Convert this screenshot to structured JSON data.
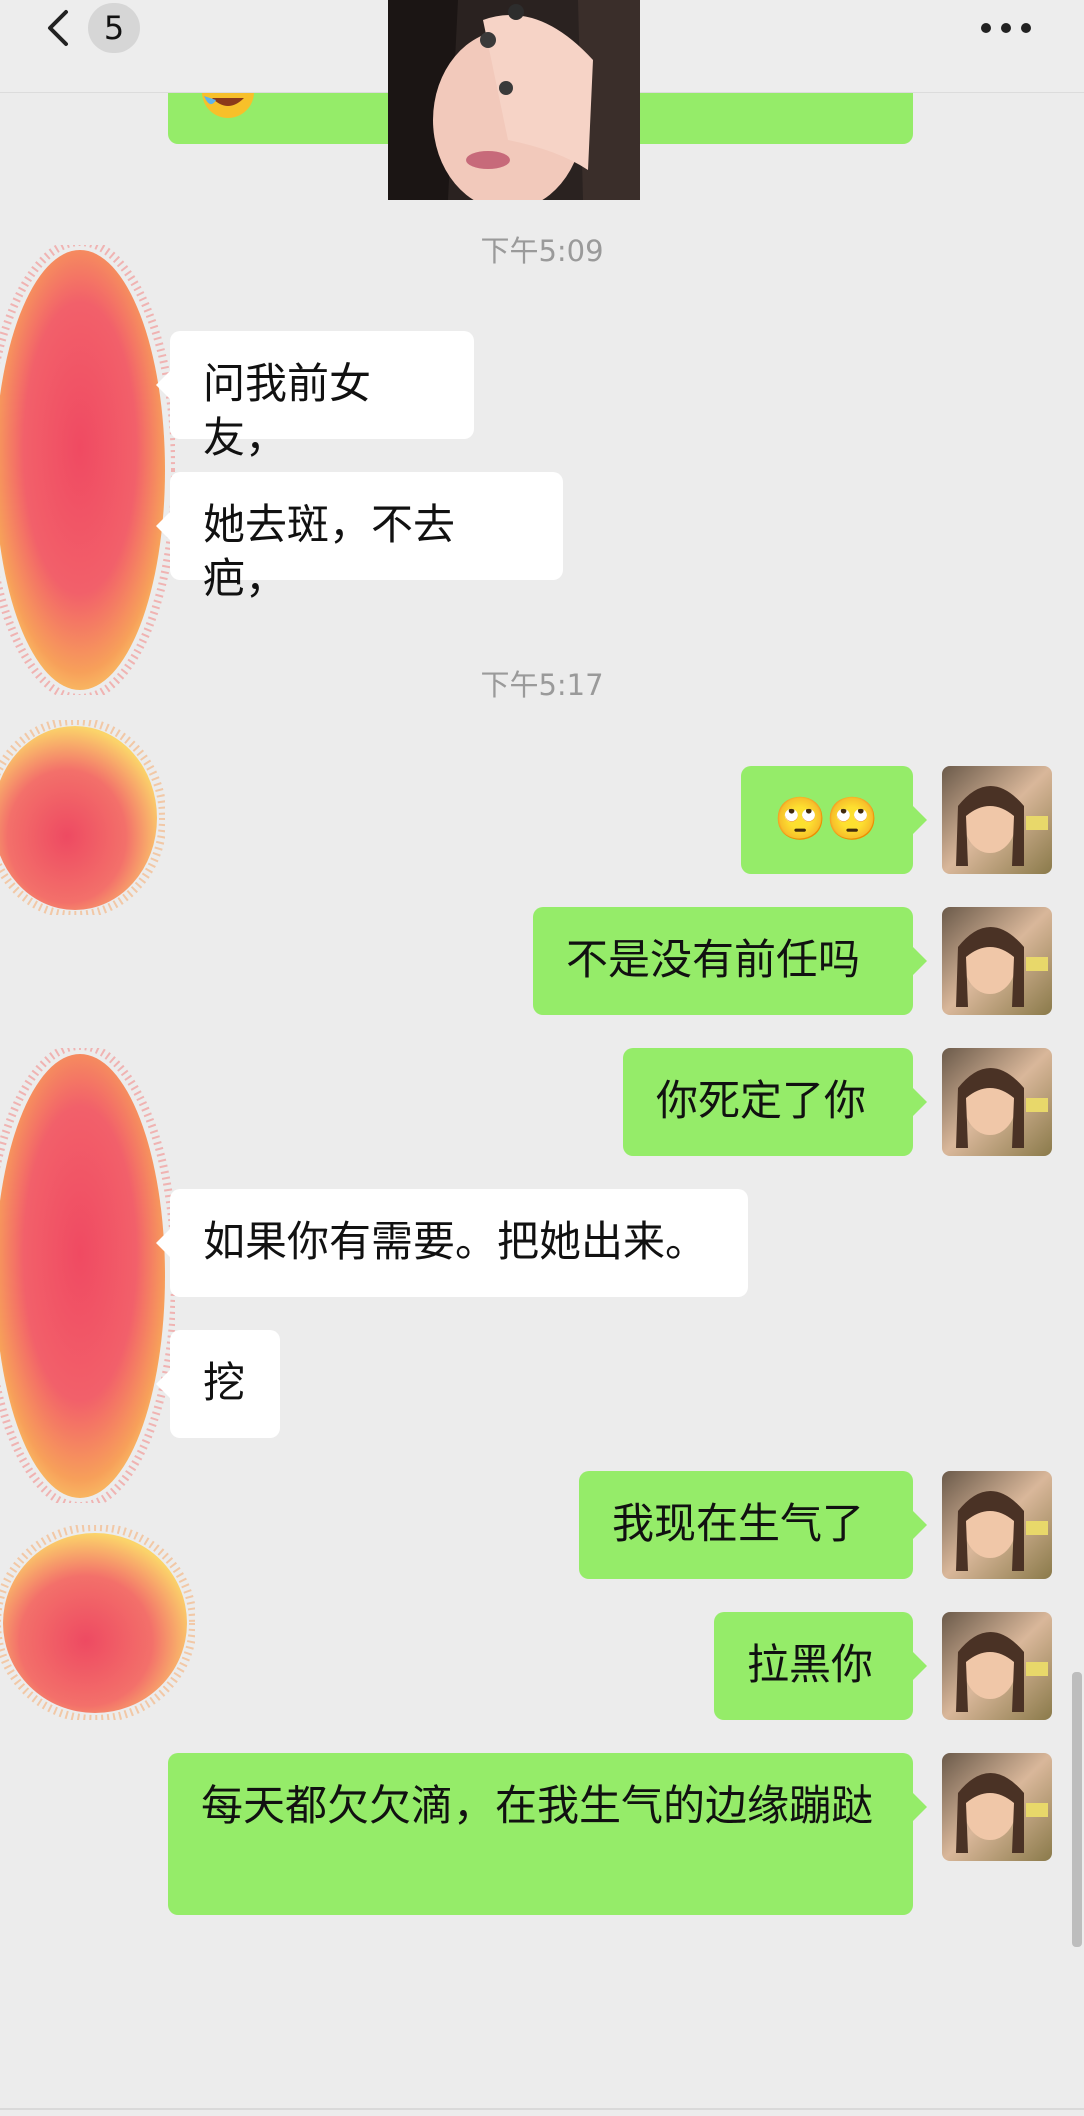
{
  "header": {
    "unread_count": "5",
    "back_icon": "chevron-left-icon",
    "more_icon": "more-dots-icon"
  },
  "messages": [
    {
      "type": "time",
      "text": "下午5:09"
    },
    {
      "type": "left",
      "text": "问我前女友，"
    },
    {
      "type": "left",
      "text": "她去斑，不去疤，"
    },
    {
      "type": "time",
      "text": "下午5:17"
    },
    {
      "type": "right",
      "text": "🙄🙄"
    },
    {
      "type": "right",
      "text": "不是没有前任吗"
    },
    {
      "type": "right",
      "text": "你死定了你"
    },
    {
      "type": "left",
      "text": "如果你有需要。把她出来。"
    },
    {
      "type": "left",
      "text": "挖"
    },
    {
      "type": "right",
      "text": "我现在生气了"
    },
    {
      "type": "right",
      "text": "拉黑你"
    },
    {
      "type": "right",
      "text": "每天都欠欠滴，在我生气的边缘蹦跶"
    }
  ],
  "colors": {
    "background": "#ececec",
    "bubble_mine": "#95ec69",
    "bubble_other": "#ffffff",
    "time_text": "#9a9a9a"
  }
}
